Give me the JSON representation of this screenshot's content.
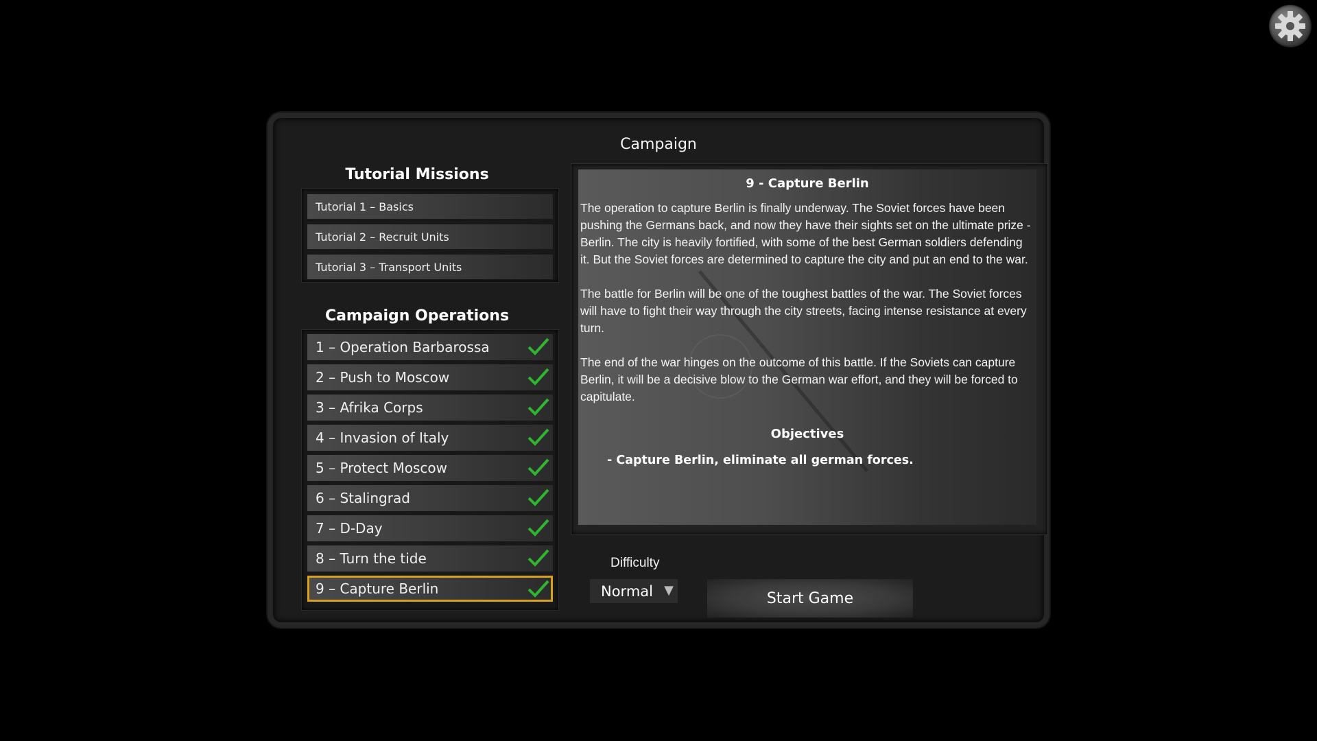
{
  "settings_icon": "gear-icon",
  "panel": {
    "title": "Campaign"
  },
  "tutorials": {
    "title": "Tutorial Missions",
    "items": [
      {
        "label": "Tutorial 1 – Basics"
      },
      {
        "label": "Tutorial 2 – Recruit Units"
      },
      {
        "label": "Tutorial 3 – Transport Units"
      }
    ]
  },
  "operations": {
    "title": "Campaign Operations",
    "items": [
      {
        "label": "1 – Operation Barbarossa",
        "completed": true
      },
      {
        "label": "2 – Push to Moscow",
        "completed": true
      },
      {
        "label": "3 – Afrika Corps",
        "completed": true
      },
      {
        "label": "4 – Invasion of Italy",
        "completed": true
      },
      {
        "label": "5 – Protect Moscow",
        "completed": true
      },
      {
        "label": "6 – Stalingrad",
        "completed": true
      },
      {
        "label": "7 – D-Day",
        "completed": true
      },
      {
        "label": "8 – Turn the tide",
        "completed": true
      },
      {
        "label": "9 – Capture Berlin",
        "completed": true,
        "selected": true
      }
    ],
    "check_icon": "checkmark-icon",
    "check_color": "#2fb52f",
    "selected_border_color": "#d9a11a"
  },
  "description": {
    "title": "9 - Capture Berlin",
    "paragraphs": [
      "The operation to capture Berlin is finally underway. The Soviet forces have been pushing the Germans back, and now they have their sights set on the ultimate prize - Berlin. The city is heavily fortified, with some of the best German soldiers defending it. But the Soviet forces are determined to capture the city and put an end to the war.",
      "The battle for Berlin will be one of the toughest battles of the war. The Soviet forces will have to fight their way through the city streets, facing intense resistance at every turn.",
      "The end of the war hinges on the outcome of this battle. If the Soviets can capture Berlin, it will be a decisive blow to the German war effort, and they will be forced to capitulate."
    ],
    "objectives_title": "Objectives",
    "objective": "- Capture Berlin, eliminate all german forces."
  },
  "difficulty": {
    "label": "Difficulty",
    "value": "Normal",
    "arrow_icon": "triangle-down-icon"
  },
  "start_button": {
    "label": "Start Game"
  }
}
